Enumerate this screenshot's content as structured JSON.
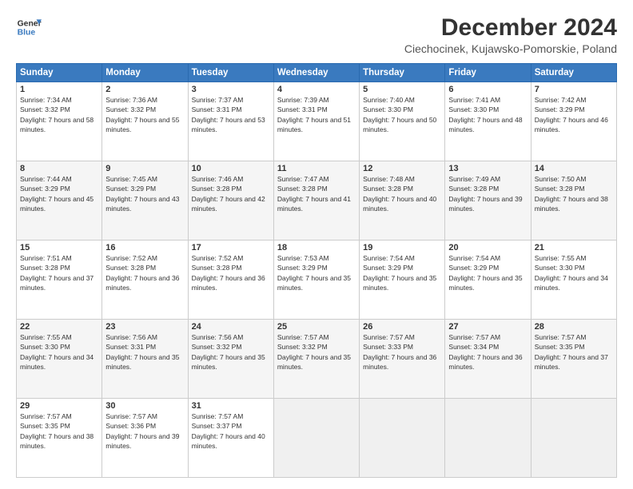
{
  "logo": {
    "line1": "General",
    "line2": "Blue"
  },
  "title": "December 2024",
  "subtitle": "Ciechocinek, Kujawsko-Pomorskie, Poland",
  "headers": [
    "Sunday",
    "Monday",
    "Tuesday",
    "Wednesday",
    "Thursday",
    "Friday",
    "Saturday"
  ],
  "weeks": [
    [
      {
        "day": "1",
        "sunrise": "7:34 AM",
        "sunset": "3:32 PM",
        "daylight": "7 hours and 58 minutes."
      },
      {
        "day": "2",
        "sunrise": "7:36 AM",
        "sunset": "3:32 PM",
        "daylight": "7 hours and 55 minutes."
      },
      {
        "day": "3",
        "sunrise": "7:37 AM",
        "sunset": "3:31 PM",
        "daylight": "7 hours and 53 minutes."
      },
      {
        "day": "4",
        "sunrise": "7:39 AM",
        "sunset": "3:31 PM",
        "daylight": "7 hours and 51 minutes."
      },
      {
        "day": "5",
        "sunrise": "7:40 AM",
        "sunset": "3:30 PM",
        "daylight": "7 hours and 50 minutes."
      },
      {
        "day": "6",
        "sunrise": "7:41 AM",
        "sunset": "3:30 PM",
        "daylight": "7 hours and 48 minutes."
      },
      {
        "day": "7",
        "sunrise": "7:42 AM",
        "sunset": "3:29 PM",
        "daylight": "7 hours and 46 minutes."
      }
    ],
    [
      {
        "day": "8",
        "sunrise": "7:44 AM",
        "sunset": "3:29 PM",
        "daylight": "7 hours and 45 minutes."
      },
      {
        "day": "9",
        "sunrise": "7:45 AM",
        "sunset": "3:29 PM",
        "daylight": "7 hours and 43 minutes."
      },
      {
        "day": "10",
        "sunrise": "7:46 AM",
        "sunset": "3:28 PM",
        "daylight": "7 hours and 42 minutes."
      },
      {
        "day": "11",
        "sunrise": "7:47 AM",
        "sunset": "3:28 PM",
        "daylight": "7 hours and 41 minutes."
      },
      {
        "day": "12",
        "sunrise": "7:48 AM",
        "sunset": "3:28 PM",
        "daylight": "7 hours and 40 minutes."
      },
      {
        "day": "13",
        "sunrise": "7:49 AM",
        "sunset": "3:28 PM",
        "daylight": "7 hours and 39 minutes."
      },
      {
        "day": "14",
        "sunrise": "7:50 AM",
        "sunset": "3:28 PM",
        "daylight": "7 hours and 38 minutes."
      }
    ],
    [
      {
        "day": "15",
        "sunrise": "7:51 AM",
        "sunset": "3:28 PM",
        "daylight": "7 hours and 37 minutes."
      },
      {
        "day": "16",
        "sunrise": "7:52 AM",
        "sunset": "3:28 PM",
        "daylight": "7 hours and 36 minutes."
      },
      {
        "day": "17",
        "sunrise": "7:52 AM",
        "sunset": "3:28 PM",
        "daylight": "7 hours and 36 minutes."
      },
      {
        "day": "18",
        "sunrise": "7:53 AM",
        "sunset": "3:29 PM",
        "daylight": "7 hours and 35 minutes."
      },
      {
        "day": "19",
        "sunrise": "7:54 AM",
        "sunset": "3:29 PM",
        "daylight": "7 hours and 35 minutes."
      },
      {
        "day": "20",
        "sunrise": "7:54 AM",
        "sunset": "3:29 PM",
        "daylight": "7 hours and 35 minutes."
      },
      {
        "day": "21",
        "sunrise": "7:55 AM",
        "sunset": "3:30 PM",
        "daylight": "7 hours and 34 minutes."
      }
    ],
    [
      {
        "day": "22",
        "sunrise": "7:55 AM",
        "sunset": "3:30 PM",
        "daylight": "7 hours and 34 minutes."
      },
      {
        "day": "23",
        "sunrise": "7:56 AM",
        "sunset": "3:31 PM",
        "daylight": "7 hours and 35 minutes."
      },
      {
        "day": "24",
        "sunrise": "7:56 AM",
        "sunset": "3:32 PM",
        "daylight": "7 hours and 35 minutes."
      },
      {
        "day": "25",
        "sunrise": "7:57 AM",
        "sunset": "3:32 PM",
        "daylight": "7 hours and 35 minutes."
      },
      {
        "day": "26",
        "sunrise": "7:57 AM",
        "sunset": "3:33 PM",
        "daylight": "7 hours and 36 minutes."
      },
      {
        "day": "27",
        "sunrise": "7:57 AM",
        "sunset": "3:34 PM",
        "daylight": "7 hours and 36 minutes."
      },
      {
        "day": "28",
        "sunrise": "7:57 AM",
        "sunset": "3:35 PM",
        "daylight": "7 hours and 37 minutes."
      }
    ],
    [
      {
        "day": "29",
        "sunrise": "7:57 AM",
        "sunset": "3:35 PM",
        "daylight": "7 hours and 38 minutes."
      },
      {
        "day": "30",
        "sunrise": "7:57 AM",
        "sunset": "3:36 PM",
        "daylight": "7 hours and 39 minutes."
      },
      {
        "day": "31",
        "sunrise": "7:57 AM",
        "sunset": "3:37 PM",
        "daylight": "7 hours and 40 minutes."
      },
      null,
      null,
      null,
      null
    ]
  ]
}
